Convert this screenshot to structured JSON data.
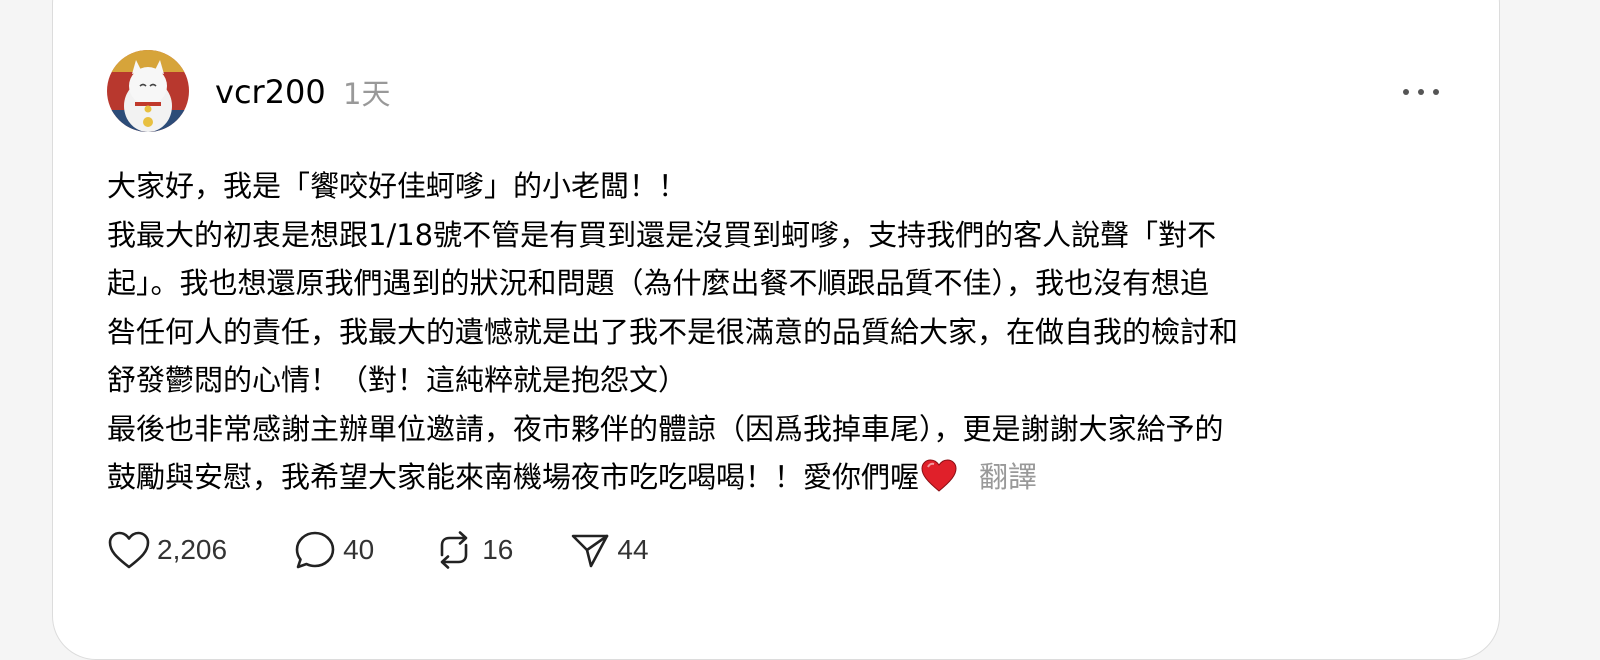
{
  "post": {
    "username": "vcr200",
    "time": "1天",
    "content_lines": [
      "大家好，我是「饗咬好佳蚵嗲」的小老闆！！",
      "我最大的初衷是想跟1/18號不管是有買到還是沒買到蚵嗲，支持我們的客人說聲「對不",
      "起」。我也想還原我們遇到的狀況和問題（為什麼出餐不順跟品質不佳），我也沒有想追",
      "咎任何人的責任，我最大的遺憾就是出了我不是很滿意的品質給大家，在做自我的檢討和",
      "舒發鬱悶的心情！（對！這純粹就是抱怨文）",
      "最後也非常感謝主辦單位邀請，夜市夥伴的體諒（因爲我掉車尾），更是謝謝大家給予的",
      "鼓勵與安慰，我希望大家能來南機場夜市吃吃喝喝！！愛你們喔"
    ],
    "translate_label": "翻譯",
    "stats": {
      "likes": "2,206",
      "comments": "40",
      "reposts": "16",
      "shares": "44"
    }
  },
  "icons": {
    "more": "more-horizontal-icon",
    "like": "heart-outline-icon",
    "comment": "comment-bubble-icon",
    "repost": "repost-arrows-icon",
    "share": "send-paper-plane-icon",
    "emoji": "red-heart-emoji"
  },
  "colors": {
    "text": "#000000",
    "muted": "#999999",
    "heart_emoji": "#e0202a"
  }
}
